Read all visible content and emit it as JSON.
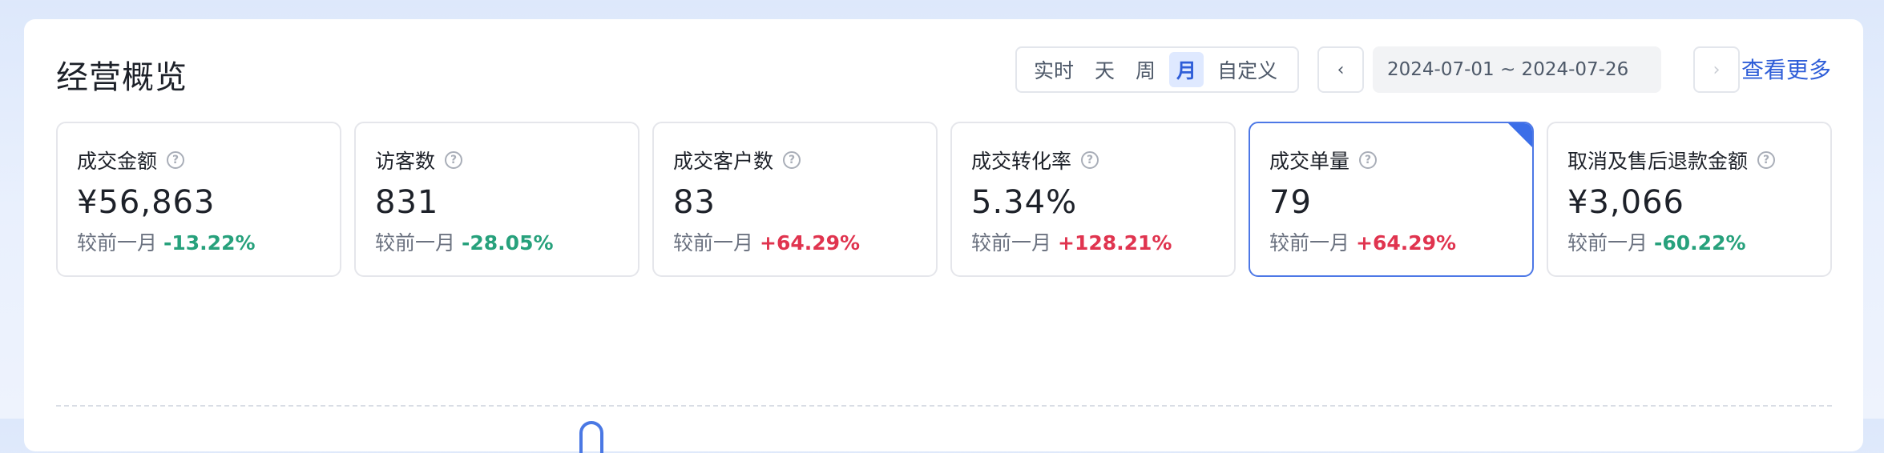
{
  "header": {
    "title": "经营概览",
    "segments": [
      "实时",
      "天",
      "周",
      "月",
      "自定义"
    ],
    "active_segment": "月",
    "date_range": "2024-07-01 ~ 2024-07-26",
    "more_label": "查看更多"
  },
  "metrics": [
    {
      "label": "成交金额",
      "value": "¥56,863",
      "compare_label": "较前一月",
      "delta": "-13.22%",
      "trend": "down",
      "selected": false
    },
    {
      "label": "访客数",
      "value": "831",
      "compare_label": "较前一月",
      "delta": "-28.05%",
      "trend": "down",
      "selected": false
    },
    {
      "label": "成交客户数",
      "value": "83",
      "compare_label": "较前一月",
      "delta": "+64.29%",
      "trend": "up",
      "selected": false
    },
    {
      "label": "成交转化率",
      "value": "5.34%",
      "compare_label": "较前一月",
      "delta": "+128.21%",
      "trend": "up",
      "selected": false
    },
    {
      "label": "成交单量",
      "value": "79",
      "compare_label": "较前一月",
      "delta": "+64.29%",
      "trend": "up",
      "selected": true
    },
    {
      "label": "取消及售后退款金额",
      "value": "¥3,066",
      "compare_label": "较前一月",
      "delta": "-60.22%",
      "trend": "down",
      "selected": false
    }
  ],
  "help_glyph": "?",
  "icons": {
    "prev": "chevron-left-icon",
    "next": "chevron-right-icon",
    "help": "question-circle-icon"
  },
  "colors": {
    "accent": "#2f5ed8",
    "up": "#e0344f",
    "down": "#27a17c"
  }
}
